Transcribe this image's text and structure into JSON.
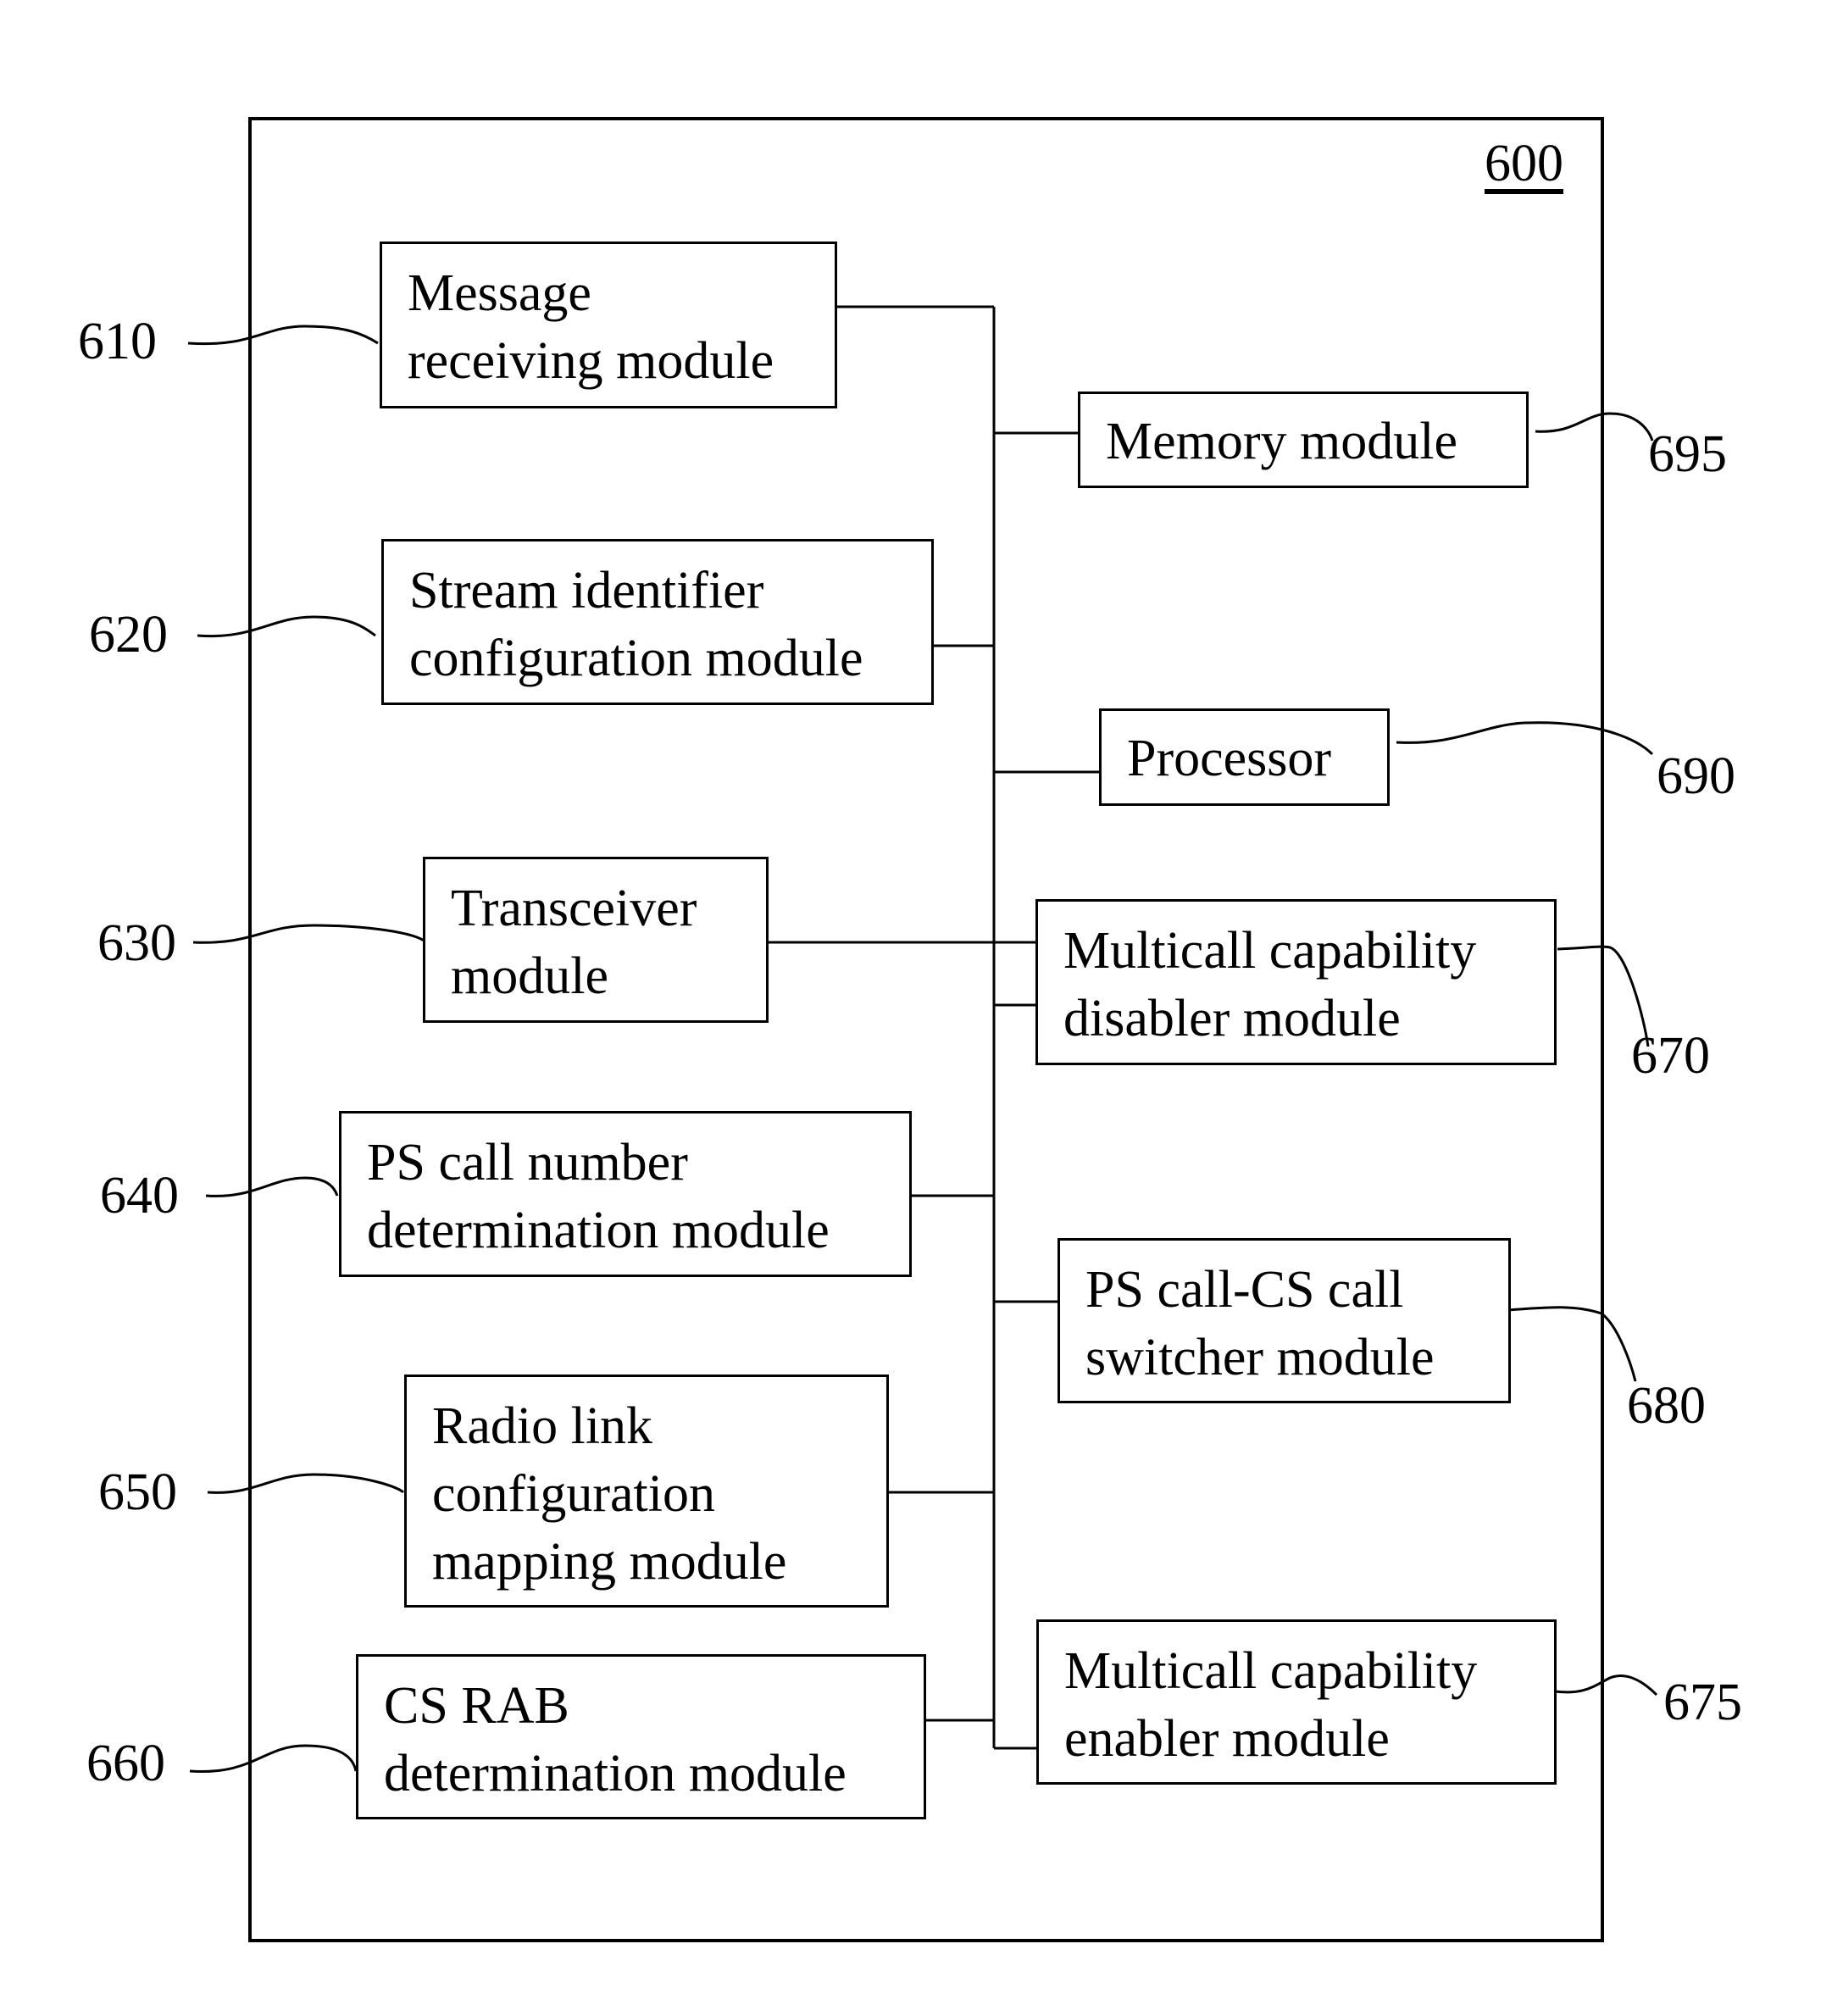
{
  "figure": {
    "title_ref": "600",
    "left_modules": [
      {
        "ref": "610",
        "label": "Message\nreceiving module"
      },
      {
        "ref": "620",
        "label": "Stream identifier\nconfiguration module"
      },
      {
        "ref": "630",
        "label": "Transceiver\nmodule"
      },
      {
        "ref": "640",
        "label": "PS call number\ndetermination module"
      },
      {
        "ref": "650",
        "label": "Radio link\nconfiguration\nmapping module"
      },
      {
        "ref": "660",
        "label": "CS RAB\ndetermination module"
      }
    ],
    "right_modules": [
      {
        "ref": "695",
        "label": "Memory module"
      },
      {
        "ref": "690",
        "label": "Processor"
      },
      {
        "ref": "670",
        "label": "Multicall capability\ndisabler module"
      },
      {
        "ref": "680",
        "label": "PS call-CS call\nswitcher module"
      },
      {
        "ref": "675",
        "label": "Multicall capability\nenabler module"
      }
    ]
  }
}
